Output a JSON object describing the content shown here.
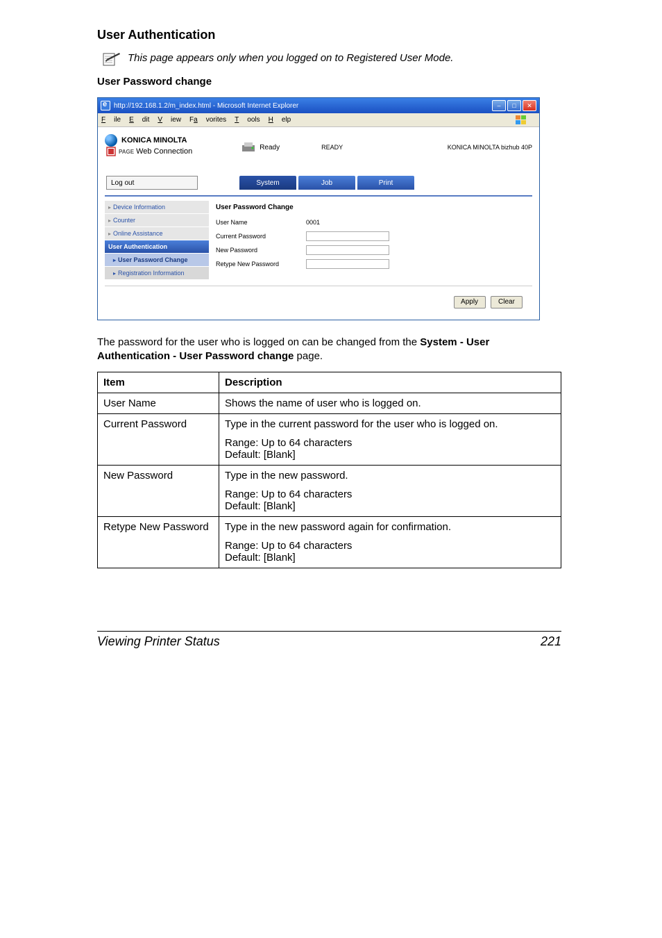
{
  "section_title": "User Authentication",
  "note_text": "This page appears only when you logged on to Registered User Mode.",
  "sub_title": "User Password change",
  "browser": {
    "title": "http://192.168.1.2/m_index.html - Microsoft Internet Explorer",
    "menu": {
      "file": "File",
      "edit": "Edit",
      "view": "View",
      "favorites": "Favorites",
      "tools": "Tools",
      "help": "Help"
    },
    "logo": "KONICA MINOLTA",
    "pagescope": "Web Connection",
    "status_label": "Ready",
    "status_word": "READY",
    "model": "KONICA MINOLTA bizhub 40P",
    "logout": "Log out",
    "tabs": {
      "system": "System",
      "job": "Job",
      "print": "Print"
    },
    "nav": {
      "device_info": "Device Information",
      "counter": "Counter",
      "online": "Online Assistance",
      "user_auth": "User Authentication",
      "user_pw": "User Password Change",
      "reg_info": "Registration Information"
    },
    "form": {
      "title": "User Password Change",
      "username_label": "User Name",
      "username_value": "0001",
      "current_pw": "Current Password",
      "new_pw": "New Password",
      "retype_pw": "Retype New Password"
    },
    "buttons": {
      "apply": "Apply",
      "clear": "Clear"
    }
  },
  "desc_line1": "The password for the user who is logged on can be changed from the ",
  "desc_bold": "System - User Authentication - User Password change",
  "desc_line2": " page.",
  "table": {
    "h1": "Item",
    "h2": "Description",
    "r1c1": "User Name",
    "r1c2": "Shows the name of user who is logged on.",
    "r2c1": "Current Password",
    "r2c2a": "Type in the current password for the user who is logged on.",
    "r2c2b_range": "Range:   Up to 64 characters",
    "r2c2b_default": "Default:  [Blank]",
    "r3c1": "New Password",
    "r3c2a": "Type in the new password.",
    "r4c1": "Retype New Password",
    "r4c2a": "Type in the new password again for confirmation."
  },
  "footer_left": "Viewing Printer Status",
  "footer_right": "221"
}
